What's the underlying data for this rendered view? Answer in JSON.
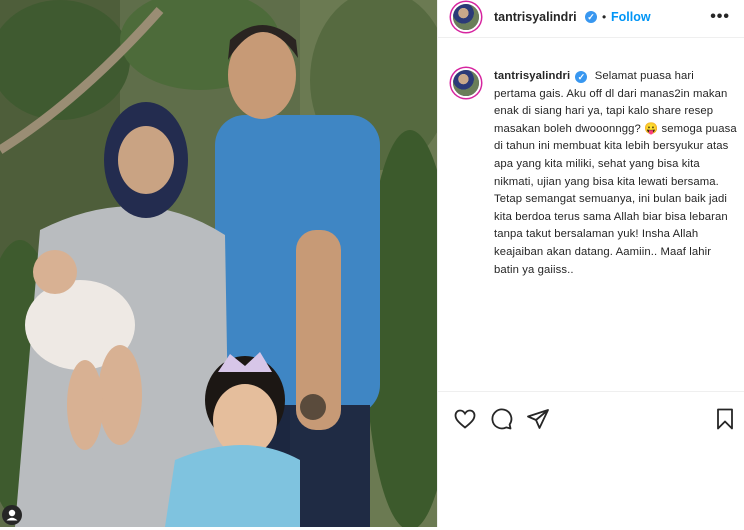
{
  "post": {
    "username": "tantrisyalindri",
    "verified_mark": "✓",
    "separator": "•",
    "follow_label": "Follow",
    "more_label": "•••"
  },
  "caption": {
    "username": "tantrisyalindri",
    "text": "Selamat puasa hari pertama gais. Aku off dl dari manas2in makan enak di siang hari ya, tapi kalo share resep masakan boleh dwooonngg? 😛 semoga puasa di tahun ini membuat kita lebih bersyukur atas apa yang kita miliki, sehat yang bisa kita nikmati, ujian yang bisa kita lewati bersama. Tetap semangat semuanya, ini bulan baik jadi kita berdoa terus sama Allah biar bisa lebaran tanpa takut bersalaman yuk! Insha Allah keajaiban akan datang. Aamiin.. Maaf lahir batin ya gaiiss.."
  },
  "actions": {
    "like_icon": "heart-outline-icon",
    "comment_icon": "comment-bubble-icon",
    "share_icon": "paper-plane-icon",
    "save_icon": "bookmark-outline-icon"
  },
  "colors": {
    "link_blue": "#0095f6",
    "verified_blue": "#3897f0",
    "text": "#262626",
    "border": "#efefef"
  }
}
